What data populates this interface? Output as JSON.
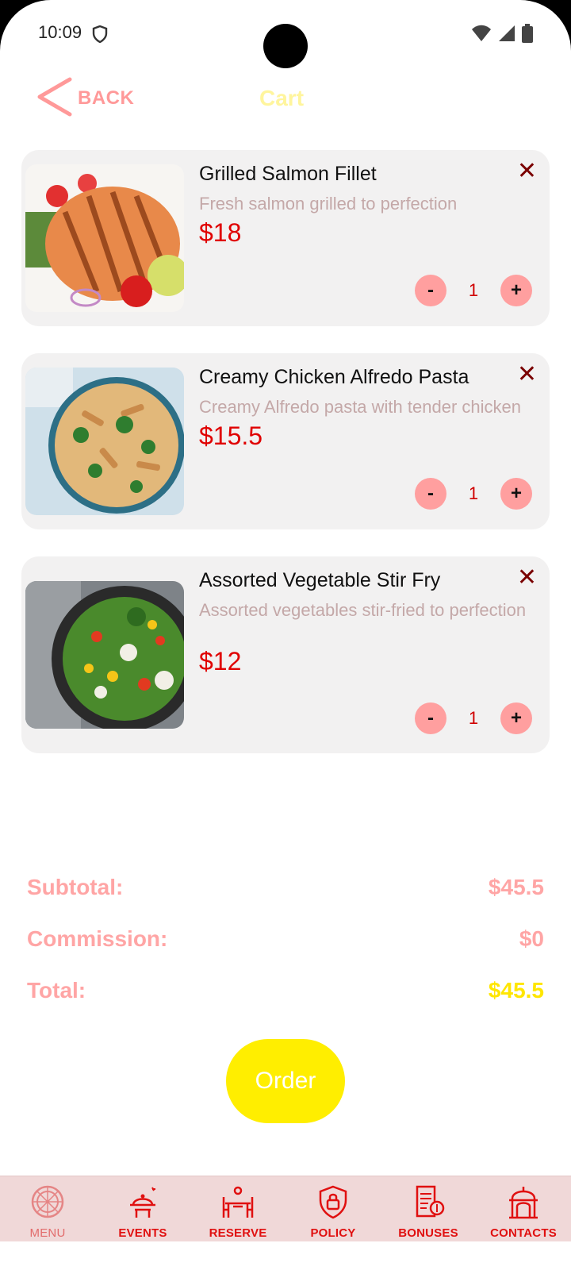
{
  "status_bar": {
    "time": "10:09"
  },
  "header": {
    "back_label": "BACK",
    "title": "Cart"
  },
  "cart_items": [
    {
      "name": "Grilled Salmon Fillet",
      "description": "Fresh salmon grilled to perfection",
      "price": "$18",
      "quantity": "1",
      "minus": "-",
      "plus": "+",
      "remove": "✕"
    },
    {
      "name": "Creamy Chicken Alfredo Pasta",
      "description": "Creamy Alfredo pasta with tender chicken",
      "price": "$15.5",
      "quantity": "1",
      "minus": "-",
      "plus": "+",
      "remove": "✕"
    },
    {
      "name": "Assorted Vegetable Stir Fry",
      "description": "Assorted vegetables stir-fried to perfection",
      "price": "$12",
      "quantity": "1",
      "minus": "-",
      "plus": "+",
      "remove": "✕"
    }
  ],
  "totals": {
    "subtotal_label": "Subtotal:",
    "subtotal_value": "$45.5",
    "commission_label": "Commission:",
    "commission_value": "$0",
    "total_label": "Total:",
    "total_value": "$45.5"
  },
  "order_button": "Order",
  "nav": [
    {
      "label": "MENU",
      "icon": "pizza-icon"
    },
    {
      "label": "EVENTS",
      "icon": "waiter-icon"
    },
    {
      "label": "RESERVE",
      "icon": "table-reserve-icon"
    },
    {
      "label": "POLICY",
      "icon": "shield-lock-icon"
    },
    {
      "label": "BONUSES",
      "icon": "receipt-coin-icon"
    },
    {
      "label": "CONTACTS",
      "icon": "building-icon"
    }
  ],
  "colors": {
    "accent": "#ff9999",
    "price": "#e00000",
    "order": "#ffee00",
    "nav_bg": "#f0d8d8"
  }
}
